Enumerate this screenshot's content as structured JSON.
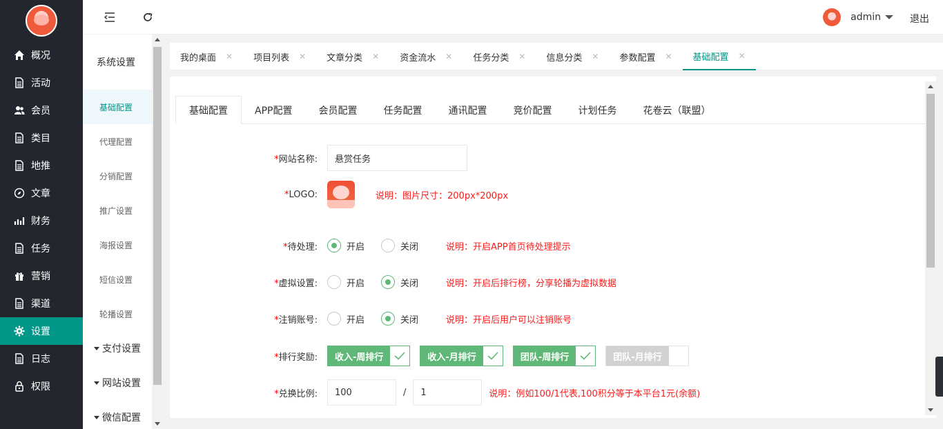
{
  "sidebar": {
    "items": [
      {
        "label": "概况",
        "icon": "home-icon"
      },
      {
        "label": "活动",
        "icon": "file-icon"
      },
      {
        "label": "会员",
        "icon": "users-icon"
      },
      {
        "label": "类目",
        "icon": "file-icon"
      },
      {
        "label": "地推",
        "icon": "file-icon"
      },
      {
        "label": "文章",
        "icon": "compass-icon"
      },
      {
        "label": "财务",
        "icon": "chart-icon"
      },
      {
        "label": "任务",
        "icon": "file-icon"
      },
      {
        "label": "营销",
        "icon": "gift-icon"
      },
      {
        "label": "渠道",
        "icon": "file-icon"
      },
      {
        "label": "设置",
        "icon": "gear-icon"
      },
      {
        "label": "日志",
        "icon": "file-icon"
      },
      {
        "label": "权限",
        "icon": "lock-icon"
      }
    ],
    "active_index": 10
  },
  "header": {
    "username": "admin",
    "logout": "退出"
  },
  "subnav": {
    "title": "系统设置",
    "items": [
      "基础配置",
      "代理配置",
      "分销配置",
      "推广设置",
      "海报设置",
      "短信设置",
      "轮播设置"
    ],
    "groups": [
      "支付设置",
      "网站设置",
      "微信配置"
    ]
  },
  "tabs": [
    "我的桌面",
    "项目列表",
    "文章分类",
    "资金流水",
    "任务分类",
    "信息分类",
    "参数配置",
    "基础配置"
  ],
  "tab_close": "✕",
  "inner_tabs": [
    "基础配置",
    "APP配置",
    "会员配置",
    "任务配置",
    "通讯配置",
    "竞价配置",
    "计划任务",
    "花卷云（联盟）"
  ],
  "form": {
    "site_name": {
      "label": "网站名称:",
      "value": "悬赏任务"
    },
    "logo": {
      "label": "LOGO:",
      "note": "说明：图片尺寸：200px*200px"
    },
    "pending": {
      "label": "待处理:",
      "on": "开启",
      "off": "关闭",
      "note": "说明：开启APP首页待处理提示"
    },
    "virtual": {
      "label": "虚拟设置:",
      "on": "开启",
      "off": "关闭",
      "note": "说明：开启后排行榜，分享轮播为虚拟数据"
    },
    "cancel_account": {
      "label": "注销账号:",
      "on": "开启",
      "off": "关闭",
      "note": "说明：开启后用户可以注销账号"
    },
    "rank_reward": {
      "label": "排行奖励:",
      "options": [
        "收入-周排行",
        "收入-月排行",
        "团队-周排行",
        "团队-月排行"
      ]
    },
    "exchange": {
      "label": "兑换比例:",
      "left": "100",
      "sep": "/",
      "right": "1",
      "note": "说明：例如100/1代表,100积分等于本平台1元(余额)"
    }
  },
  "required_mark": "*",
  "colors": {
    "accent": "#009688",
    "check_green": "#5fb878",
    "note_red": "#ff1a1a",
    "sidebar_bg": "#23262e"
  }
}
